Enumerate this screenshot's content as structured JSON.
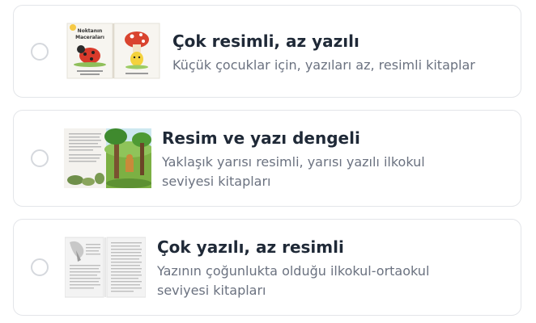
{
  "options": [
    {
      "title": "Çok resimli, az yazılı",
      "description": "Küçük çocuklar için, yazıları az, resimli kitaplar",
      "thumbnail": {
        "icon": "illustrated-book-icon",
        "book_title": "Noktanın Maceraları"
      },
      "selected": false
    },
    {
      "title": "Resim ve yazı dengeli",
      "description": "Yaklaşık yarısı resimli, yarısı yazılı ilkokul seviyesi kitapları",
      "thumbnail": {
        "icon": "balanced-book-icon"
      },
      "selected": false
    },
    {
      "title": "Çok yazılı, az resimli",
      "description": "Yazının çoğunlukta olduğu ilkokul-ortaokul seviyesi kitapları",
      "thumbnail": {
        "icon": "text-heavy-book-icon"
      },
      "selected": false
    }
  ],
  "colors": {
    "title": "#1f2937",
    "description": "#6b7280",
    "border": "#e3e5e9",
    "radio": "#d5d8dd"
  }
}
